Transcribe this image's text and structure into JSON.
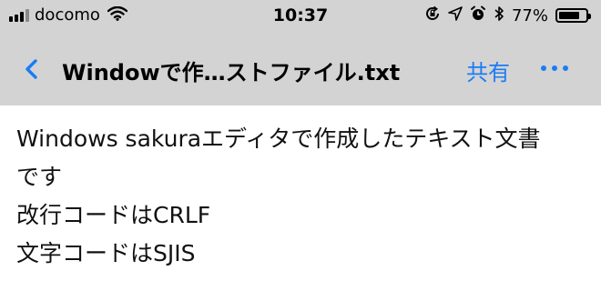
{
  "status_bar": {
    "carrier": "docomo",
    "time": "10:37",
    "battery_percent": "77%",
    "battery_level": 0.77,
    "icons": [
      "signal-icon",
      "wifi-icon",
      "rotation-lock-icon",
      "location-icon",
      "alarm-icon",
      "bluetooth-icon",
      "battery-icon"
    ]
  },
  "nav": {
    "back_icon": "chevron-left-icon",
    "title": "Windowで作…ストファイル.txt",
    "share_label": "共有",
    "more_icon": "more-icon"
  },
  "document": {
    "lines": [
      "Windows sakuraエディタで作成したテキスト文書",
      "です",
      "改行コードはCRLF",
      "文字コードはSJIS"
    ]
  },
  "colors": {
    "header_bg": "#d3d3d3",
    "accent": "#1a7cf5"
  }
}
